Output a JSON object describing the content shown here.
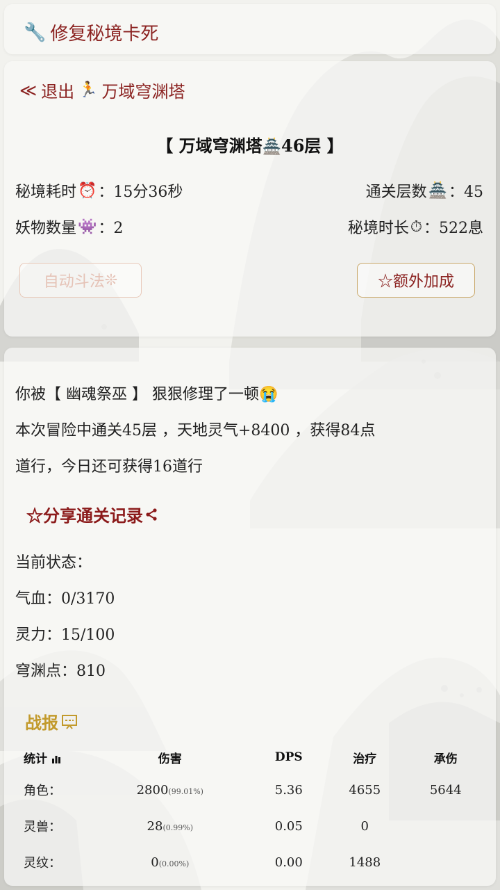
{
  "header": {
    "fix_label": "修复秘境卡死",
    "wrench_icon": "🔧"
  },
  "main": {
    "back_arrow": "≪",
    "back_label": "退出",
    "back_emoji": "🏃",
    "realm_name": "万域穹渊塔",
    "title_prefix": "【 万域穹渊塔",
    "title_emoji": "🏯",
    "title_suffix": "46层 】",
    "elapsed_label": "秘境耗时",
    "elapsed_emoji": "⏰",
    "elapsed_value": "：15分36秒",
    "floors_label": "通关层数",
    "floors_emoji": "🏯",
    "floors_value": "：45",
    "monsters_label": "妖物数量",
    "monsters_emoji": "👾",
    "monsters_value": "：2",
    "duration_label": "秘境时长",
    "duration_emoji": "⏱",
    "duration_value": "：522息",
    "auto_button": "自动斗法",
    "auto_emoji": "❊",
    "bonus_button": "☆额外加成"
  },
  "log": {
    "line1_a": "你被【 幽魂祭巫 】 狠狠修理了一顿",
    "line1_emoji": "😭",
    "line2": "本次冒险中通关45层 ，天地灵气+8400 ，获得84点",
    "line3": "道行，今日还可获得16道行",
    "share_label": "☆分享通关记录",
    "share_icon": "<",
    "status_title": "当前状态：",
    "hp": "气血：0/3170",
    "mana": "灵力：15/100",
    "abyss_points": "穹渊点：810"
  },
  "report": {
    "title": "战报",
    "headers": [
      "统计",
      "伤害",
      "DPS",
      "治疗",
      "承伤"
    ],
    "rows": [
      {
        "name": "角色：",
        "damage": "2800",
        "pct": "(99.01%)",
        "dps": "5.36",
        "heal": "4655",
        "taken": "5644"
      },
      {
        "name": "灵兽：",
        "damage": "28",
        "pct": "(0.99%)",
        "dps": "0.05",
        "heal": "0",
        "taken": ""
      },
      {
        "name": "灵纹：",
        "damage": "0",
        "pct": "(0.00%)",
        "dps": "0.00",
        "heal": "1488",
        "taken": ""
      }
    ]
  },
  "colors": {
    "accent_red": "#8b2220",
    "gold": "#c29a2c"
  }
}
